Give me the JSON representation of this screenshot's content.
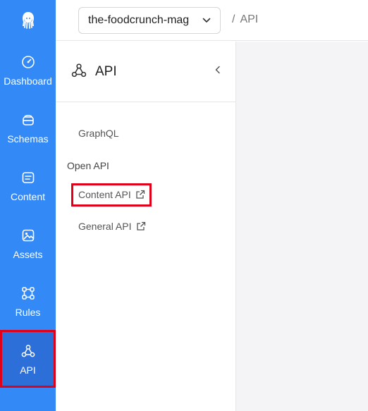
{
  "app_selector": {
    "value": "the-foodcrunch-mag"
  },
  "breadcrumb": {
    "separator": "/",
    "current": "API"
  },
  "rail": {
    "items": [
      {
        "label": "Dashboard",
        "icon": "dashboard-icon"
      },
      {
        "label": "Schemas",
        "icon": "schemas-icon"
      },
      {
        "label": "Content",
        "icon": "content-icon"
      },
      {
        "label": "Assets",
        "icon": "assets-icon"
      },
      {
        "label": "Rules",
        "icon": "rules-icon"
      },
      {
        "label": "API",
        "icon": "api-icon",
        "active": true
      }
    ]
  },
  "panel": {
    "title": "API",
    "links": {
      "graphql": "GraphQL",
      "open_api_group": "Open API",
      "content_api": "Content API",
      "general_api": "General API"
    }
  },
  "colors": {
    "rail": "#3389f5",
    "rail_active": "#2d6fd8",
    "highlight": "#e1001a",
    "content_bg": "#f4f4f6"
  }
}
